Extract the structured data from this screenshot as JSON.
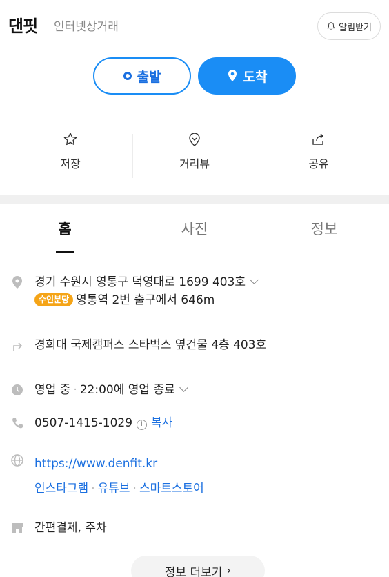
{
  "header": {
    "title": "댄핏",
    "category": "인터넷상거래",
    "notify_label": "알림받기"
  },
  "route": {
    "start_label": "출발",
    "end_label": "도착"
  },
  "actions": [
    {
      "label": "저장",
      "icon": "star-icon"
    },
    {
      "label": "거리뷰",
      "icon": "street-view-icon"
    },
    {
      "label": "공유",
      "icon": "share-icon"
    }
  ],
  "tabs": [
    {
      "label": "홈",
      "active": true
    },
    {
      "label": "사진",
      "active": false
    },
    {
      "label": "정보",
      "active": false
    }
  ],
  "info": {
    "address": "경기 수원시 영통구 덕영대로 1699 403호",
    "subway_badge": "수인분당",
    "subway_text": "영통역 2번 출구에서 646m",
    "directions": "경희대 국제캠퍼스 스타벅스 옆건물 4층 403호",
    "status": "영업 중",
    "status_separator": "·",
    "hours": "22:00에 영업 종료",
    "phone": "0507-1415-1029",
    "phone_info_icon": "i",
    "copy_label": "복사",
    "website": "https://www.denfit.kr",
    "links": [
      "인스타그램",
      "유튜브",
      "스마트스토어"
    ],
    "link_separator": "·",
    "facilities": "간편결제, 주차"
  },
  "more_label": "정보 더보기",
  "more_arrow": "›",
  "colors": {
    "accent": "#1a8df5",
    "link": "#1a6fe0",
    "badge": "#f5a417",
    "icon_gray": "#bdbdbd"
  }
}
